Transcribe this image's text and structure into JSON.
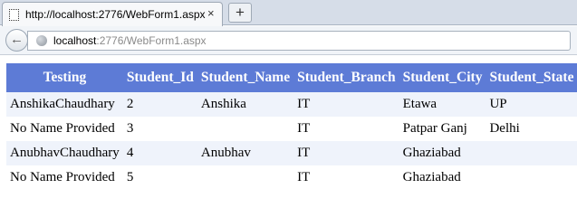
{
  "browser": {
    "tab_title": "http://localhost:2776/WebForm1.aspx",
    "tab_close": "×",
    "new_tab": "+",
    "back": "←",
    "url_host": "localhost",
    "url_path": ":2776/WebForm1.aspx"
  },
  "grid": {
    "headers": [
      "Testing",
      "Student_Id",
      "Student_Name",
      "Student_Branch",
      "Student_City",
      "Student_State"
    ],
    "rows": [
      [
        "AnshikaChaudhary",
        "2",
        "Anshika",
        "IT",
        "Etawa",
        "UP"
      ],
      [
        "No Name Provided",
        "3",
        "",
        "IT",
        "Patpar Ganj",
        "Delhi"
      ],
      [
        "AnubhavChaudhary",
        "4",
        "Anubhav",
        "IT",
        "Ghaziabad",
        ""
      ],
      [
        "No Name Provided",
        "5",
        "",
        "IT",
        "Ghaziabad",
        ""
      ]
    ],
    "colors": {
      "header_bg": "#5d7bd6",
      "alt_row_bg": "#eff3fb"
    }
  }
}
